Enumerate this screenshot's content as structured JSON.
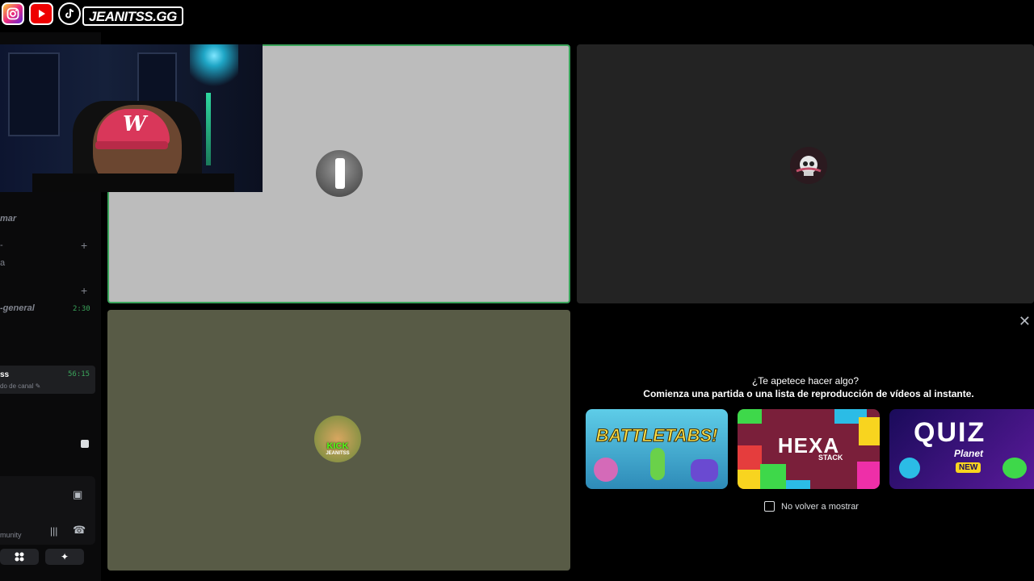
{
  "social": {
    "handle": "JEANITSS.GG",
    "icons": [
      "instagram-icon",
      "youtube-icon",
      "tiktok-icon"
    ]
  },
  "sidebar": {
    "category_partial": "mar",
    "channel_a_partial": "a",
    "voice_channel": {
      "name": "general",
      "time": "2:30"
    },
    "current_user": {
      "name": "ss",
      "time": "56:15",
      "status": "do de canal"
    },
    "community_partial": "munity"
  },
  "tiles": [
    {
      "id": "tile1",
      "speaking": true,
      "bg": "#bcbcbc"
    },
    {
      "id": "tile2",
      "speaking": false,
      "bg": "#232323"
    },
    {
      "id": "tile3",
      "speaking": false,
      "bg": "#585b46",
      "avatar_text": "KICK",
      "avatar_sub": "JEANITSS"
    }
  ],
  "activity": {
    "question": "¿Te apetece hacer algo?",
    "subtitle": "Comienza una partida o una lista de reproducción de vídeos al instante.",
    "games": [
      {
        "name": "BATTLETABS!"
      },
      {
        "name": "HEXA",
        "sub": "STACK"
      },
      {
        "name": "QUIZ",
        "sub": "Planet",
        "badge": "NEW"
      }
    ],
    "dont_show": "No volver a mostrar"
  },
  "colors": {
    "speaking_border": "#3ba55c",
    "accent_time": "#3ba55c"
  }
}
